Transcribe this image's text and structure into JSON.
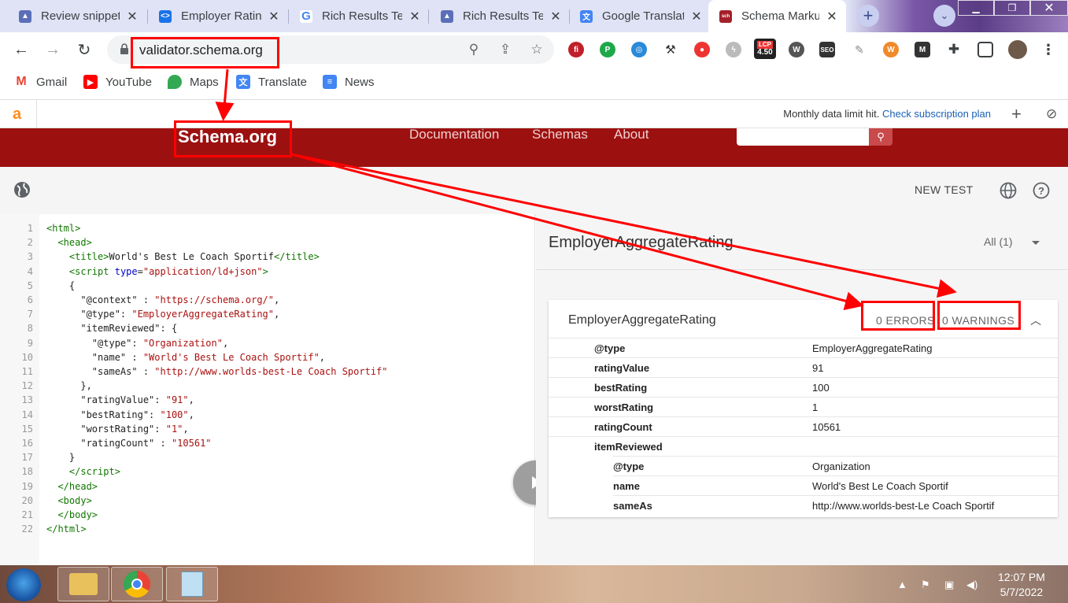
{
  "browser": {
    "tabs": [
      {
        "title": "Review snippet",
        "favicon_color": "#5b6fb8"
      },
      {
        "title": "Employer Rating",
        "favicon_color": "#1a73e8"
      },
      {
        "title": "Rich Results Test",
        "favicon_color": "#ffffff"
      },
      {
        "title": "Rich Results Test",
        "favicon_color": "#5b6fb8"
      },
      {
        "title": "Google Translate",
        "favicon_color": "#4285f4"
      },
      {
        "title": "Schema Markup",
        "favicon_color": "#a3202a"
      }
    ],
    "active_tab_index": 5,
    "address": "validator.schema.org",
    "extension_badge": "4.50",
    "extension_badge_label": "LCP",
    "bookmarks": [
      "Gmail",
      "YouTube",
      "Maps",
      "Translate",
      "News"
    ]
  },
  "extension_bar": {
    "logo": "a",
    "message": "Monthly data limit hit.",
    "link": "Check subscription plan"
  },
  "site_header": {
    "logo": "Schema.org",
    "nav": [
      "Documentation",
      "Schemas",
      "About"
    ]
  },
  "validator": {
    "new_test_label": "NEW TEST",
    "code_lines": [
      {
        "n": "1",
        "html": "<span class='tg'>&lt;html&gt;</span>"
      },
      {
        "n": "2",
        "html": "  <span class='tg'>&lt;head&gt;</span>"
      },
      {
        "n": "3",
        "html": "    <span class='tg'>&lt;title&gt;</span>World's Best Le Coach Sportif<span class='tg'>&lt;/title&gt;</span>"
      },
      {
        "n": "4",
        "html": "    <span class='tg'>&lt;script</span> <span class='at'>type</span>=<span class='st'>\"application/ld+json\"</span><span class='tg'>&gt;</span>"
      },
      {
        "n": "5",
        "html": "    {"
      },
      {
        "n": "6",
        "html": "      \"@context\" : <span class='st'>\"https://schema.org/\"</span>,"
      },
      {
        "n": "7",
        "html": "      \"@type\": <span class='st'>\"EmployerAggregateRating\"</span>,"
      },
      {
        "n": "8",
        "html": "      \"itemReviewed\": {"
      },
      {
        "n": "9",
        "html": "        \"@type\": <span class='st'>\"Organization\"</span>,"
      },
      {
        "n": "10",
        "html": "        \"name\" : <span class='st'>\"World's Best Le Coach Sportif\"</span>,"
      },
      {
        "n": "11",
        "html": "        \"sameAs\" : <span class='st'>\"http://www.worlds-best-Le Coach Sportif\"</span>"
      },
      {
        "n": "12",
        "html": "      },"
      },
      {
        "n": "13",
        "html": "      \"ratingValue\": <span class='st'>\"91\"</span>,"
      },
      {
        "n": "14",
        "html": "      \"bestRating\": <span class='st'>\"100\"</span>,"
      },
      {
        "n": "15",
        "html": "      \"worstRating\": <span class='st'>\"1\"</span>,"
      },
      {
        "n": "16",
        "html": "      \"ratingCount\" : <span class='st'>\"10561\"</span>"
      },
      {
        "n": "17",
        "html": "    }"
      },
      {
        "n": "18",
        "html": "    <span class='tg'>&lt;/script&gt;</span>"
      },
      {
        "n": "19",
        "html": "  <span class='tg'>&lt;/head&gt;</span>"
      },
      {
        "n": "20",
        "html": "  <span class='tg'>&lt;body&gt;</span>"
      },
      {
        "n": "21",
        "html": "  <span class='tg'>&lt;/body&gt;</span>"
      },
      {
        "n": "22",
        "html": "<span class='tg'>&lt;/html&gt;</span>"
      }
    ],
    "result_title": "EmployerAggregateRating",
    "filter": "All (1)",
    "card_title": "EmployerAggregateRating",
    "errors": "0 ERRORS",
    "warnings": "0 WARNINGS",
    "properties": [
      {
        "key": "@type",
        "value": "EmployerAggregateRating",
        "indent": 0
      },
      {
        "key": "ratingValue",
        "value": "91",
        "indent": 0
      },
      {
        "key": "bestRating",
        "value": "100",
        "indent": 0
      },
      {
        "key": "worstRating",
        "value": "1",
        "indent": 0
      },
      {
        "key": "ratingCount",
        "value": "10561",
        "indent": 0
      },
      {
        "key": "itemReviewed",
        "value": "",
        "indent": 0
      },
      {
        "key": "@type",
        "value": "Organization",
        "indent": 1
      },
      {
        "key": "name",
        "value": "World's Best Le Coach Sportif",
        "indent": 1
      },
      {
        "key": "sameAs",
        "value": "http://www.worlds-best-Le Coach Sportif",
        "indent": 1
      }
    ]
  },
  "taskbar": {
    "time": "12:07 PM",
    "date": "5/7/2022"
  },
  "colors": {
    "annotation": "#ff0000",
    "schema_red": "#9d1010"
  }
}
